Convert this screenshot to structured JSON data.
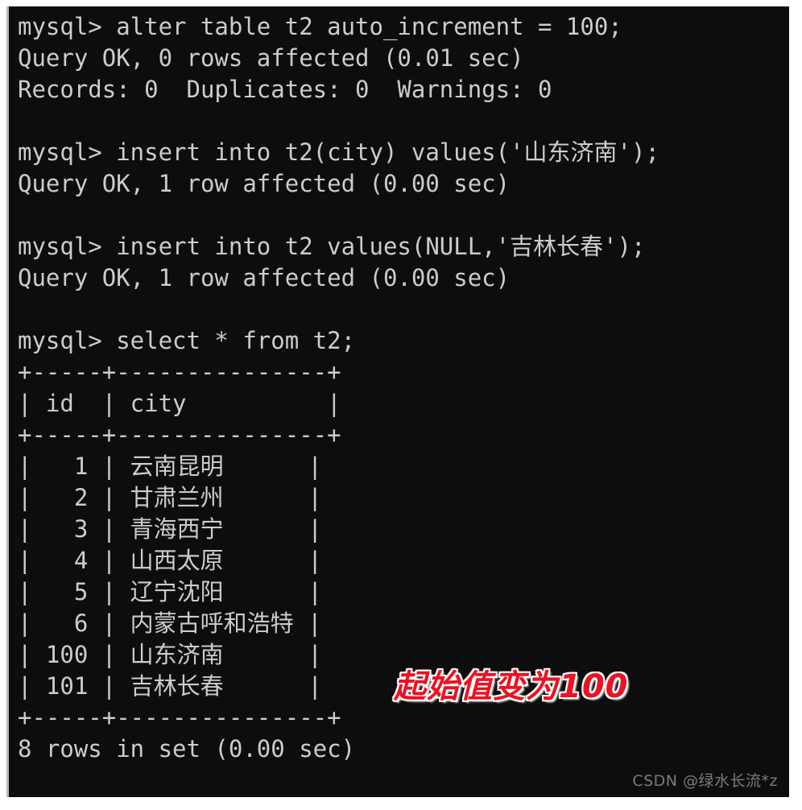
{
  "terminal": {
    "background_color": "#0d0d0d",
    "text_color": "#cccccc",
    "lines": [
      "mysql> alter table t2 auto_increment = 100;",
      "Query OK, 0 rows affected (0.01 sec)",
      "Records: 0  Duplicates: 0  Warnings: 0",
      "",
      "mysql> insert into t2(city) values('山东济南');",
      "Query OK, 1 row affected (0.00 sec)",
      "",
      "mysql> insert into t2 values(NULL,'吉林长春');",
      "Query OK, 1 row affected (0.00 sec)",
      "",
      "mysql> select * from t2;",
      "+-----+---------------+",
      "| id  | city          |",
      "+-----+---------------+",
      "|   1 | 云南昆明      |",
      "|   2 | 甘肃兰州      |",
      "|   3 | 青海西宁      |",
      "|   4 | 山西太原      |",
      "|   5 | 辽宁沈阳      |",
      "|   6 | 内蒙古呼和浩特 |",
      "| 100 | 山东济南      |",
      "| 101 | 吉林长春      |",
      "+-----+---------------+",
      "8 rows in set (0.00 sec)"
    ],
    "commands": [
      "alter table t2 auto_increment = 100;",
      "insert into t2(city) values('山东济南');",
      "insert into t2 values(NULL,'吉林长春');",
      "select * from t2;"
    ],
    "prompt": "mysql>",
    "result_table": {
      "columns": [
        "id",
        "city"
      ],
      "rows": [
        {
          "id": "1",
          "city": "云南昆明"
        },
        {
          "id": "2",
          "city": "甘肃兰州"
        },
        {
          "id": "3",
          "city": "青海西宁"
        },
        {
          "id": "4",
          "city": "山西太原"
        },
        {
          "id": "5",
          "city": "辽宁沈阳"
        },
        {
          "id": "6",
          "city": "内蒙古呼和浩特"
        },
        {
          "id": "100",
          "city": "山东济南"
        },
        {
          "id": "101",
          "city": "吉林长春"
        }
      ],
      "row_count_text": "8 rows in set (0.00 sec)"
    },
    "status_messages": [
      "Query OK, 0 rows affected (0.01 sec)",
      "Records: 0  Duplicates: 0  Warnings: 0",
      "Query OK, 1 row affected (0.00 sec)",
      "Query OK, 1 row affected (0.00 sec)"
    ]
  },
  "annotation": {
    "text": "起始值变为100",
    "color": "#ee1122",
    "outline_color": "#ffffff"
  },
  "watermark": {
    "text": "CSDN @绿水长流*z",
    "color": "#bebebe"
  }
}
